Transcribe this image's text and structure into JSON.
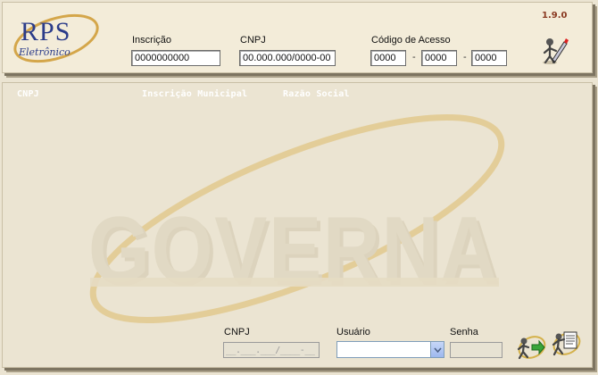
{
  "app": {
    "version": "1.9.0",
    "logo_title": "RPS",
    "logo_subtitle": "Eletrônico"
  },
  "header_form": {
    "inscricao": {
      "label": "Inscrição",
      "value": "0000000000"
    },
    "cnpj": {
      "label": "CNPJ",
      "value": "00.000.000/0000-00"
    },
    "codigo_acesso": {
      "label": "Código de Acesso",
      "part1": "0000",
      "part2": "0000",
      "part3": "0000",
      "separator": "-"
    }
  },
  "grid": {
    "columns": [
      "CNPJ",
      "Inscrição Municipal",
      "Razão Social"
    ]
  },
  "watermark_text": "GOVERNA",
  "login_form": {
    "cnpj": {
      "label": "CNPJ",
      "placeholder": "__.___.___/____-__"
    },
    "usuario": {
      "label": "Usuário",
      "value": ""
    },
    "senha": {
      "label": "Senha",
      "value": ""
    }
  },
  "icons": {
    "edit": "pencil-icon",
    "login": "enter-icon",
    "exit": "exit-icon"
  },
  "colors": {
    "background": "#ebe4d2",
    "header_background": "#f3ecd9",
    "version_text": "#8a3a22",
    "logo_blue": "#2b3c8a",
    "logo_orbit": "#d4a64a",
    "watermark_orbit": "#e2c98e"
  }
}
